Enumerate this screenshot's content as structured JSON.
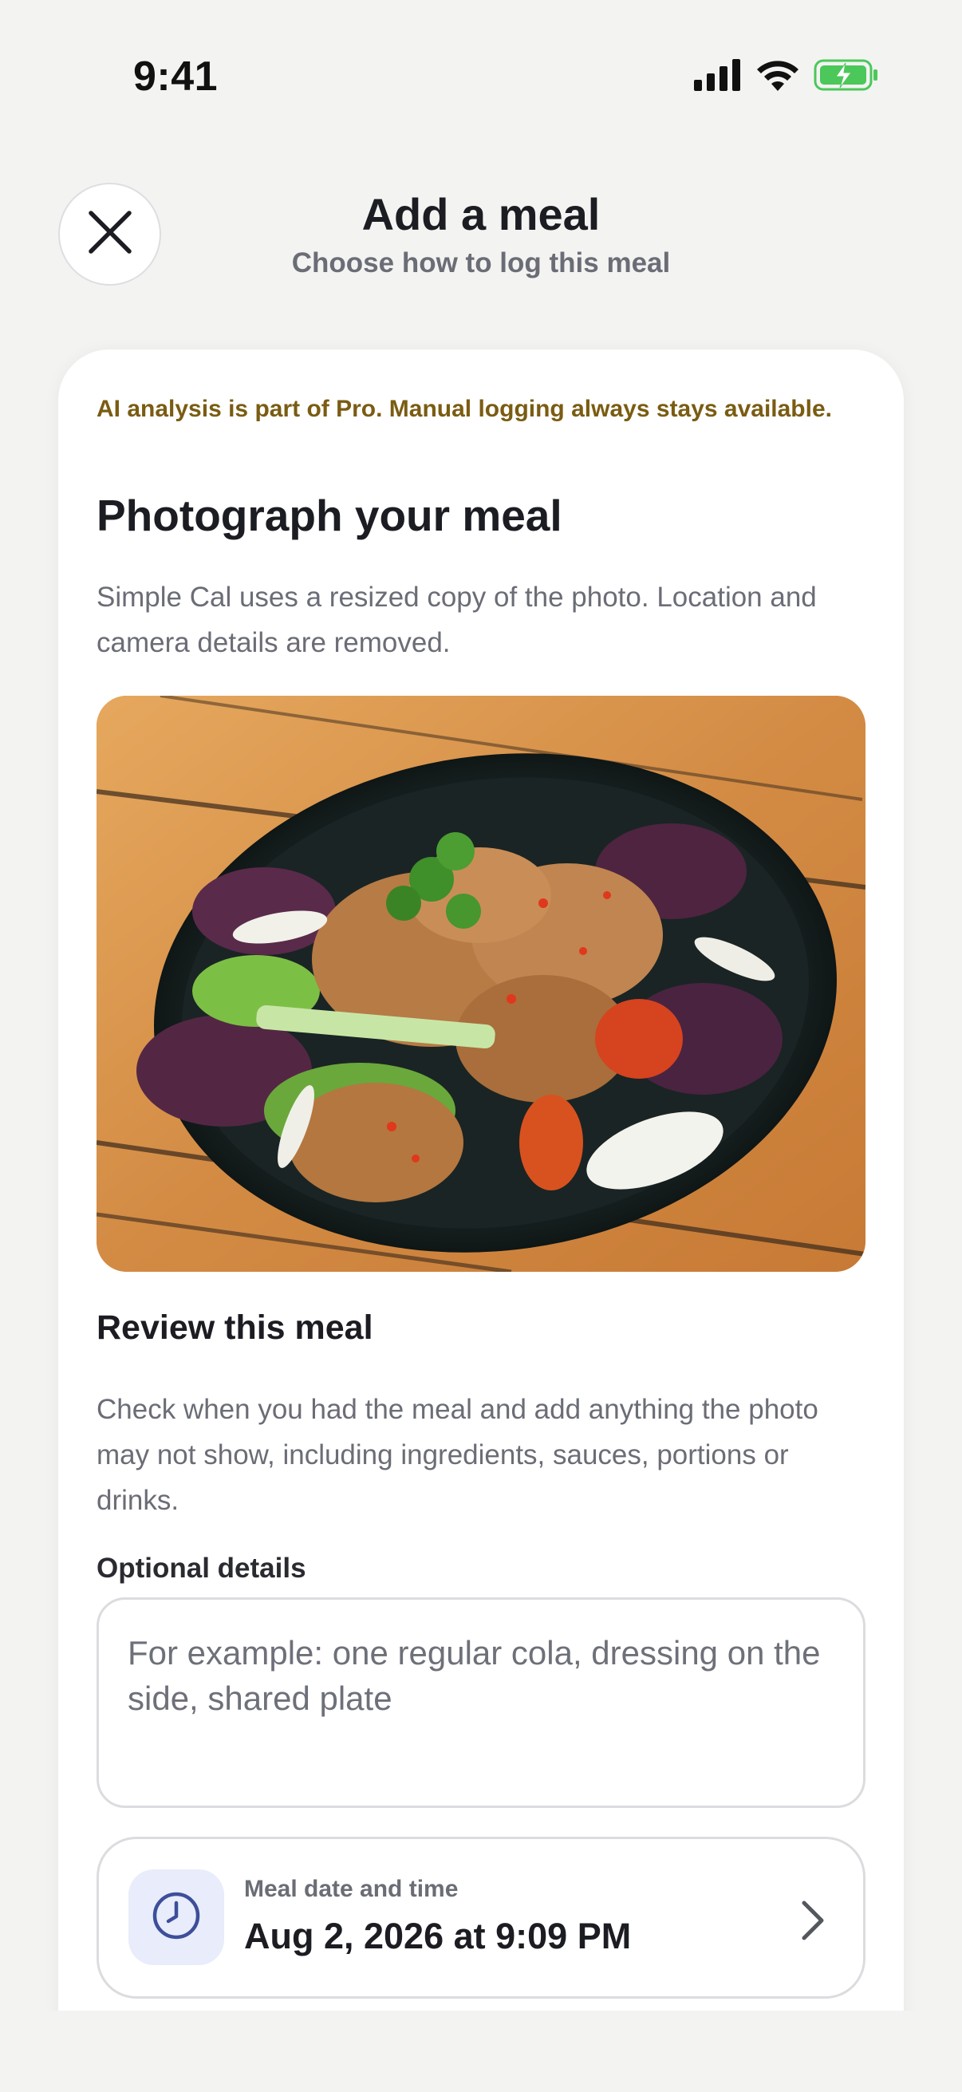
{
  "status_bar": {
    "time": "9:41",
    "icons": [
      "signal-icon",
      "wifi-icon",
      "battery-charging-icon"
    ],
    "battery_color": "#4cc75a"
  },
  "header": {
    "close_icon": "close-icon",
    "title": "Add a meal",
    "subtitle": "Choose how to log this meal"
  },
  "card": {
    "pro_note": "AI analysis is part of Pro. Manual logging always stays available.",
    "title": "Photograph your meal",
    "description": "Simple Cal uses a resized copy of the photo. Location and camera details are removed.",
    "review_title": "Review this meal",
    "review_description": "Check when you had the meal and add anything the photo may not show, including ingredients, sauces, portions or drinks.",
    "optional_label": "Optional details",
    "details_placeholder": "For example: one regular cola, dressing on the side, shared plate",
    "details_value": "",
    "datetime": {
      "icon": "clock-icon",
      "label": "Meal date and time",
      "value": "Aug 2, 2026 at 9:09 PM",
      "chevron_icon": "chevron-right-icon"
    }
  },
  "colors": {
    "background": "#f3f3f1",
    "card": "#ffffff",
    "pro_note": "#7a5c12",
    "accent_icon": "#3d4f9a",
    "accent_bg": "#e9ecfa"
  }
}
